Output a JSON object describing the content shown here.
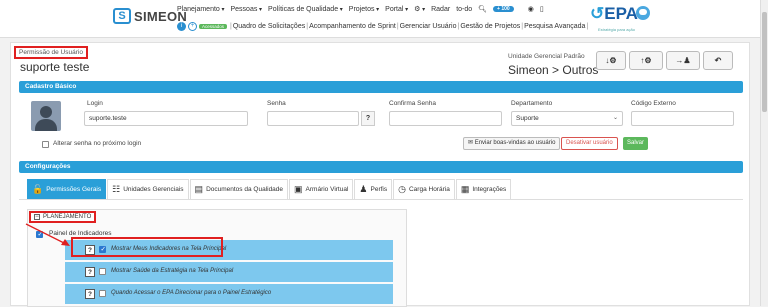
{
  "header": {
    "logo_text": "SIMEON",
    "menu": [
      "Planejamento",
      "Pessoas",
      "Políticas de Qualidade",
      "Projetos",
      "Portal",
      "⚙",
      "Radar"
    ],
    "todo_label": "to-do",
    "new_badge": "+ 100",
    "submenu": [
      "Quadro de Solicitações",
      "Acompanhamento de Sprint",
      "Gerenciar Usuário",
      "Gestão de Projetos",
      "Pesquisa Avançada"
    ],
    "access_badge": "Acessados",
    "brand": "EPA",
    "brand_sub": "Estratégia para ação"
  },
  "page": {
    "title_label": "Permissão de Usuário",
    "title": "suporte teste",
    "unit_label": "Unidade Gerencial Padrão",
    "unit_value": "Simeon > Outros",
    "nav_buttons": [
      "↓⚙",
      "↑⚙",
      "→♟",
      "↶"
    ]
  },
  "cadastro": {
    "section_title": "Cadastro Básico",
    "login_label": "Login",
    "login_value": "suporte.teste",
    "senha_label": "Senha",
    "senha_value": "",
    "confirma_label": "Confirma Senha",
    "confirma_value": "",
    "departamento_label": "Departamento",
    "departamento_value": "Suporte",
    "codigo_label": "Código Externo",
    "codigo_value": "",
    "alterar_senha_label": "Alterar senha no próximo login",
    "btn_send": "Enviar boas-vindas ao usuário",
    "btn_deactivate": "Desativar usuário",
    "btn_save": "Salvar",
    "q_mark": "?"
  },
  "config": {
    "section_title": "Configurações",
    "tabs": [
      {
        "icon": "🔓",
        "label": "Permissões Gerais"
      },
      {
        "icon": "☷",
        "label": "Unidades Gerenciais"
      },
      {
        "icon": "▤",
        "label": "Documentos da Qualidade"
      },
      {
        "icon": "▣",
        "label": "Armário Virtual"
      },
      {
        "icon": "♟",
        "label": "Perfis"
      },
      {
        "icon": "◷",
        "label": "Carga Horária"
      },
      {
        "icon": "▦",
        "label": "Integrações"
      }
    ]
  },
  "tree": {
    "minus": "−",
    "planejamento": "PLANEJAMENTO",
    "painel": "Painel de Indicadores",
    "items": [
      {
        "q": "?",
        "text": "Mostrar Meus Indicadores na Tela Principal",
        "checked": true
      },
      {
        "q": "?",
        "text": "Mostrar Saúde da Estratégia na Tela Principal",
        "checked": false
      },
      {
        "q": "?",
        "text": "Quando Acessar o EPA Direcionar para o Painel Estratégico",
        "checked": false
      }
    ]
  },
  "colors": {
    "accent": "#2a9fd8",
    "highlight": "#e02020",
    "row": "#7dc8ee",
    "save": "#5cb85c"
  }
}
